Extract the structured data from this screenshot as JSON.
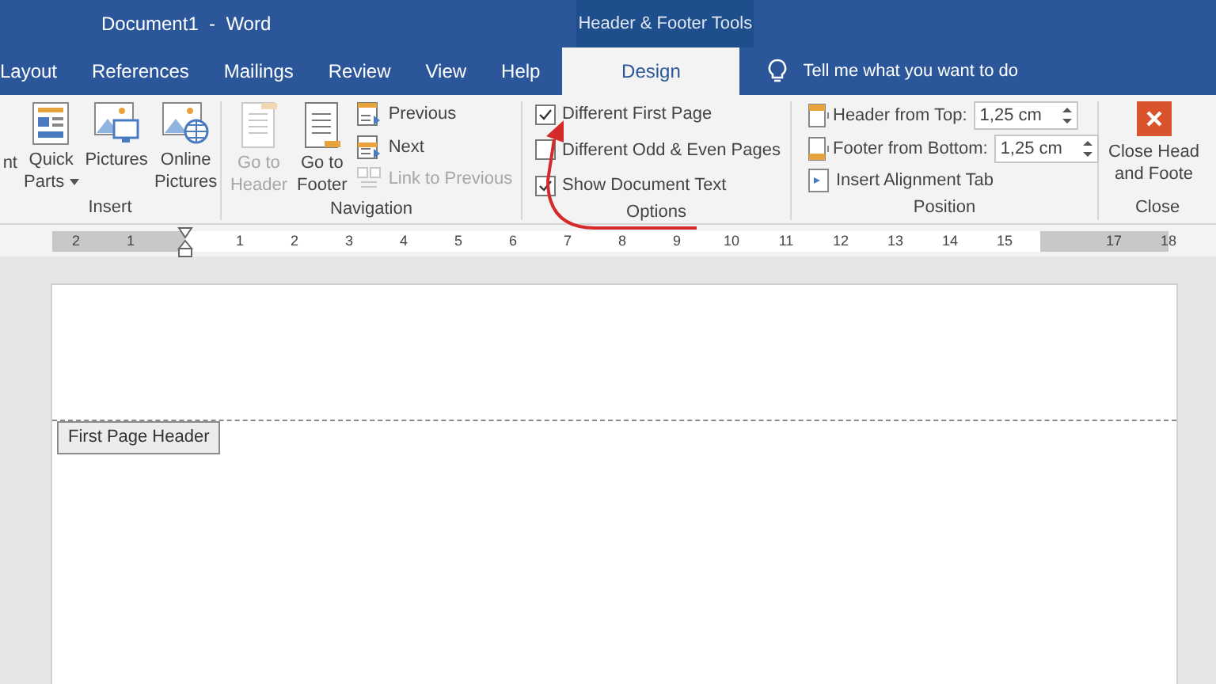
{
  "title_bar": {
    "document_title": "Document1  -  Word",
    "context_title": "Header & Footer Tools"
  },
  "tabs": [
    {
      "label": "Layout",
      "selected": false
    },
    {
      "label": "References",
      "selected": false
    },
    {
      "label": "Mailings",
      "selected": false
    },
    {
      "label": "Review",
      "selected": false
    },
    {
      "label": "View",
      "selected": false
    },
    {
      "label": "Help",
      "selected": false
    },
    {
      "label": "Design",
      "selected": true
    }
  ],
  "tell_me": {
    "placeholder": "Tell me what you want to do"
  },
  "groups": {
    "insert": {
      "label": "Insert",
      "buttons": [
        {
          "kind": "cut",
          "lines": [
            "nt"
          ]
        },
        {
          "kind": "quickparts",
          "lines": [
            "Quick",
            "Parts"
          ],
          "dropdown": true
        },
        {
          "kind": "pictures",
          "lines": [
            "Pictures"
          ]
        },
        {
          "kind": "online",
          "lines": [
            "Online",
            "Pictures"
          ]
        }
      ]
    },
    "navigation": {
      "label": "Navigation",
      "large": [
        {
          "kind": "header",
          "lines": [
            "Go to",
            "Header"
          ],
          "disabled": true
        },
        {
          "kind": "footer",
          "lines": [
            "Go to",
            "Footer"
          ],
          "disabled": false
        }
      ],
      "small": [
        {
          "label": "Previous",
          "disabled": false
        },
        {
          "label": "Next",
          "disabled": false
        },
        {
          "label": "Link to Previous",
          "disabled": true
        }
      ]
    },
    "options": {
      "label": "Options",
      "checkboxes": [
        {
          "label": "Different First Page",
          "checked": true
        },
        {
          "label": "Different Odd & Even Pages",
          "checked": false
        },
        {
          "label": "Show Document Text",
          "checked": true
        }
      ]
    },
    "position": {
      "label": "Position",
      "spinners": [
        {
          "label": "Header from Top:",
          "value": "1,25 cm"
        },
        {
          "label": "Footer from Bottom:",
          "value": "1,25 cm"
        }
      ],
      "button": "Insert Alignment Tab"
    },
    "close": {
      "label": "Close",
      "lines": [
        "Close Head",
        "and Foote"
      ]
    }
  },
  "ruler": {
    "left_labels": [
      "2",
      "1"
    ],
    "labels": [
      "1",
      "2",
      "3",
      "4",
      "5",
      "6",
      "7",
      "8",
      "9",
      "10",
      "11",
      "12",
      "13",
      "14",
      "15"
    ],
    "right_labels": [
      "17",
      "18"
    ]
  },
  "document": {
    "header_tag": "First Page Header"
  }
}
